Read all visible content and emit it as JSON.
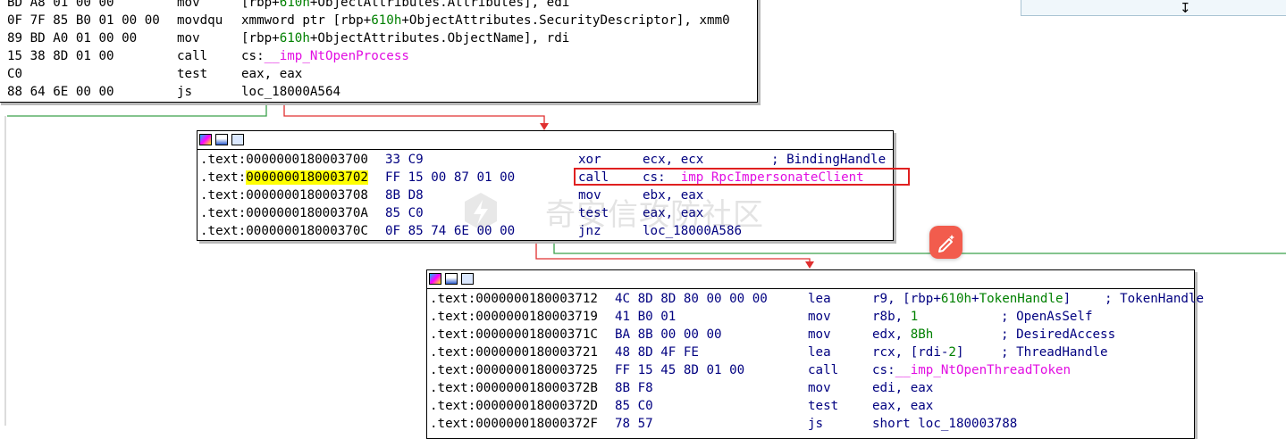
{
  "top_block": {
    "rows": [
      {
        "bytes": "BD A8 01 00 00",
        "mnemonic": "mov",
        "op_pre": "[rbp+",
        "op_num": "610h",
        "op_mid": "+ObjectAttributes.Attributes], edi",
        "op_name": "",
        "op_post": ""
      },
      {
        "bytes": "0F 7F 85 B0 01 00 00",
        "mnemonic": "movdqu",
        "op_pre": "xmmword ptr [rbp+",
        "op_num": "610h",
        "op_mid": "+ObjectAttributes.SecurityDescriptor], xmm0",
        "op_name": "",
        "op_post": ""
      },
      {
        "bytes": "89 BD A0 01 00 00",
        "mnemonic": "mov",
        "op_pre": "[rbp+",
        "op_num": "610h",
        "op_mid": "+ObjectAttributes.ObjectName], rdi",
        "op_name": "",
        "op_post": ""
      },
      {
        "bytes": "15 38 8D 01 00",
        "mnemonic": "call",
        "op_pre": "cs:",
        "op_num": "",
        "op_mid": "",
        "op_name": "__imp_NtOpenProcess",
        "op_post": ""
      },
      {
        "bytes": "C0",
        "mnemonic": "test",
        "op_pre": "eax, eax",
        "op_num": "",
        "op_mid": "",
        "op_name": "",
        "op_post": ""
      },
      {
        "bytes": "88 64 6E 00 00",
        "mnemonic": "js",
        "op_pre": "loc_18000A564",
        "op_num": "",
        "op_mid": "",
        "op_name": "",
        "op_post": ""
      }
    ]
  },
  "mid_block": {
    "rows": [
      {
        "seg": ".text:",
        "addr": "0000000180003700",
        "bytes": "33 C9",
        "mnemonic": "xor",
        "operands": "ecx, ecx",
        "comment": "; BindingHandle",
        "highlight": false
      },
      {
        "seg": ".text:",
        "addr": "0000000180003702",
        "bytes": "FF 15 00 87 01 00",
        "mnemonic": "call",
        "operands_pre": "cs:",
        "operands_name": "__imp_RpcImpersonateClient",
        "comment": "",
        "highlight": true
      },
      {
        "seg": ".text:",
        "addr": "0000000180003708",
        "bytes": "8B D8",
        "mnemonic": "mov",
        "operands": "ebx, eax",
        "comment": "",
        "highlight": false
      },
      {
        "seg": ".text:",
        "addr": "000000018000370A",
        "bytes": "85 C0",
        "mnemonic": "test",
        "operands": "eax, eax",
        "comment": "",
        "highlight": false
      },
      {
        "seg": ".text:",
        "addr": "000000018000370C",
        "bytes": "0F 85 74 6E 00 00",
        "mnemonic": "jnz",
        "operands": "loc_18000A586",
        "comment": "",
        "highlight": false
      }
    ]
  },
  "bottom_block": {
    "rows": [
      {
        "seg": ".text:",
        "addr": "0000000180003712",
        "bytes": "4C 8D 8D 80 00 00 00",
        "mnemonic": "lea",
        "op_a": "r9, [rbp+",
        "op_num": "610h",
        "op_b": "+",
        "op_name": "TokenHandle",
        "op_c": "]",
        "comment": "; TokenHandle"
      },
      {
        "seg": ".text:",
        "addr": "0000000180003719",
        "bytes": "41 B0 01",
        "mnemonic": "mov",
        "op_a": "r8b, ",
        "op_num": "1",
        "op_b": "",
        "op_name": "",
        "op_c": "",
        "comment": "; OpenAsSelf"
      },
      {
        "seg": ".text:",
        "addr": "000000018000371C",
        "bytes": "BA 8B 00 00 00",
        "mnemonic": "mov",
        "op_a": "edx, ",
        "op_num": "8Bh",
        "op_b": "",
        "op_name": "",
        "op_c": "",
        "comment": "; DesiredAccess"
      },
      {
        "seg": ".text:",
        "addr": "0000000180003721",
        "bytes": "48 8D 4F FE",
        "mnemonic": "lea",
        "op_a": "rcx, [rdi-",
        "op_num": "2",
        "op_b": "]",
        "op_name": "",
        "op_c": "",
        "comment": "; ThreadHandle"
      },
      {
        "seg": ".text:",
        "addr": "0000000180003725",
        "bytes": "FF 15 45 8D 01 00",
        "mnemonic": "call",
        "op_a": "cs:",
        "op_num": "",
        "op_b": "",
        "op_name": "",
        "op_c": "",
        "pink": "__imp_NtOpenThreadToken",
        "comment": ""
      },
      {
        "seg": ".text:",
        "addr": "000000018000372B",
        "bytes": "8B F8",
        "mnemonic": "mov",
        "op_a": "edi, eax",
        "op_num": "",
        "op_b": "",
        "op_name": "",
        "op_c": "",
        "comment": ""
      },
      {
        "seg": ".text:",
        "addr": "000000018000372D",
        "bytes": "85 C0",
        "mnemonic": "test",
        "op_a": "eax, eax",
        "op_num": "",
        "op_b": "",
        "op_name": "",
        "op_c": "",
        "comment": ""
      },
      {
        "seg": ".text:",
        "addr": "000000018000372F",
        "bytes": "78 57",
        "mnemonic": "js",
        "op_a": "short loc_180003788",
        "op_num": "",
        "op_b": "",
        "op_name": "",
        "op_c": "",
        "comment": ""
      }
    ]
  },
  "watermark": "奇安信攻防社区",
  "colors": {
    "navy": "#000080",
    "pink": "#e20ee2",
    "green": "#008000",
    "highlight": "#ffff00",
    "red_box": "#e02020",
    "edge_red": "#e03030",
    "edge_green": "#3aa04a",
    "fab": "#f25c4d"
  },
  "icons": [
    "graph-color-icon",
    "edit-node-icon",
    "node-type-icon",
    "magic-pen-icon",
    "pin-icon"
  ]
}
